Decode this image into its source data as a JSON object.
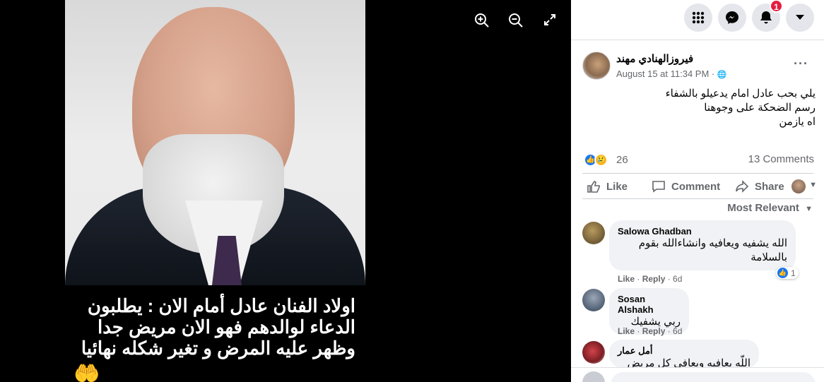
{
  "viewer": {
    "caption_lines": [
      "اولاد الفنان عادل أمام الان : يطلبون",
      "الدعاء لوالدهم فهو الان مريض جدا",
      "وظهر عليه المرض و تغير شكله نهائيا"
    ],
    "zoom_in_icon": "zoom-in-icon",
    "zoom_out_icon": "zoom-out-icon",
    "fullscreen_icon": "fullscreen-icon",
    "hands_emoji": "🤲"
  },
  "topbar": {
    "menu_icon": "⣿",
    "messenger_icon": "✉",
    "notifications_icon": "🔔",
    "notifications_badge": "1",
    "account_icon": "▾"
  },
  "post": {
    "author": "فيروزالهنادي مهند",
    "meta": "August 15 at 11:34 PM · ",
    "privacy_icon": "🌐",
    "more": "···",
    "text_lines": [
      "يلي بحب عادل امام يدعيلو بالشفاء",
      "رسم الضحكة على وجوهنا",
      "اه يازمن"
    ],
    "reaction_count": "26",
    "comments_count": "13 Comments",
    "actions": {
      "like": "Like",
      "comment": "Comment",
      "share": "Share"
    },
    "sort_label": "Most Relevant"
  },
  "comments": [
    {
      "name": "Salowa Ghadban",
      "text_lines": [
        "الله يشفيه ويعافيه وانشاءالله بقوم",
        "بالسلامة"
      ],
      "like": "Like",
      "reply": "Reply",
      "time": "6d",
      "reaction_count": "1"
    },
    {
      "name": "Sosan Alshakh",
      "text_lines": [
        "ربي يشفيك"
      ],
      "like": "Like",
      "reply": "Reply",
      "time": "6d"
    },
    {
      "name": "أمل عمار",
      "text_lines": [
        "اللّه يعافيه ويعافي كل مريض"
      ]
    }
  ],
  "colors": {
    "accent": "#1877f2",
    "badge": "#e41e3f",
    "muted": "#65676b",
    "bubble": "#f0f2f5"
  }
}
